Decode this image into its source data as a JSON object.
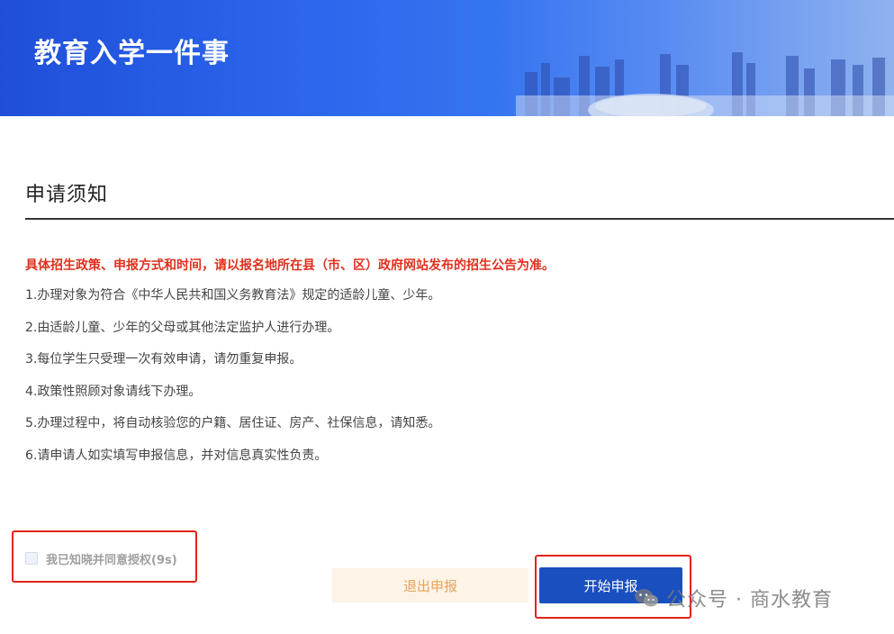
{
  "header": {
    "title": "教育入学一件事"
  },
  "notice": {
    "title": "申请须知",
    "highlight": "具体招生政策、申报方式和时间，请以报名地所在县（市、区）政府网站发布的招生公告为准。",
    "items": [
      "1.办理对象为符合《中华人民共和国义务教育法》规定的适龄儿童、少年。",
      "2.由适龄儿童、少年的父母或其他法定监护人进行办理。",
      "3.每位学生只受理一次有效申请，请勿重复申报。",
      "4.政策性照顾对象请线下办理。",
      "5.办理过程中，将自动核验您的户籍、居住证、房产、社保信息，请知悉。",
      "6.请申请人如实填写申报信息，并对信息真实性负责。"
    ]
  },
  "agreement": {
    "label": "我已知晓并同意授权(9s)",
    "checked": false
  },
  "actions": {
    "exit_label": "退出申报",
    "start_label": "开始申报"
  },
  "watermark": {
    "text": "公众号 · 商水教育",
    "icon": "wechat-icon"
  },
  "colors": {
    "highlight_red": "#e0301e",
    "primary_blue": "#1a4fc0",
    "annotation_red": "#e2231a"
  }
}
